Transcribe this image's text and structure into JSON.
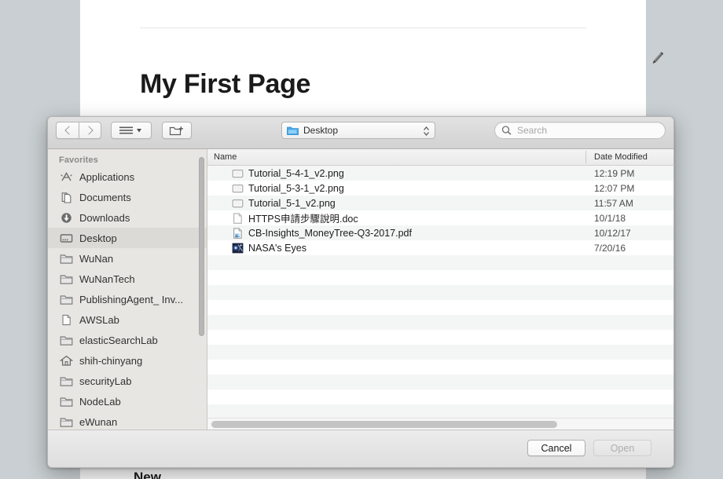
{
  "background": {
    "page_title": "My First Page",
    "edit_icon": "pencil-icon",
    "footer_text": "New"
  },
  "dialog": {
    "toolbar": {
      "back_icon": "chevron-left-icon",
      "forward_icon": "chevron-right-icon",
      "view_icon": "list-view-icon",
      "view_chevron_icon": "chevron-down-icon",
      "new_folder_icon": "new-folder-icon",
      "path": {
        "label": "Desktop",
        "folder_icon": "blue-folder-icon",
        "stepper_icon": "up-down-chevron-icon"
      },
      "search": {
        "placeholder": "Search",
        "icon": "search-icon"
      }
    },
    "sidebar": {
      "header": "Favorites",
      "items": [
        {
          "label": "Applications",
          "icon": "applications-icon",
          "selected": false
        },
        {
          "label": "Documents",
          "icon": "documents-icon",
          "selected": false
        },
        {
          "label": "Downloads",
          "icon": "downloads-icon",
          "selected": false
        },
        {
          "label": "Desktop",
          "icon": "desktop-icon",
          "selected": true
        },
        {
          "label": "WuNan",
          "icon": "folder-icon",
          "selected": false
        },
        {
          "label": "WuNanTech",
          "icon": "folder-icon",
          "selected": false
        },
        {
          "label": "PublishingAgent_ Inv...",
          "icon": "folder-icon",
          "selected": false
        },
        {
          "label": "AWSLab",
          "icon": "document-icon",
          "selected": false
        },
        {
          "label": "elasticSearchLab",
          "icon": "folder-icon",
          "selected": false
        },
        {
          "label": "shih-chinyang",
          "icon": "home-icon",
          "selected": false
        },
        {
          "label": "securityLab",
          "icon": "folder-icon",
          "selected": false
        },
        {
          "label": "NodeLab",
          "icon": "folder-icon",
          "selected": false
        },
        {
          "label": "eWunan",
          "icon": "folder-icon",
          "selected": false
        }
      ]
    },
    "filelist": {
      "columns": {
        "name": "Name",
        "date_modified": "Date Modified"
      },
      "rows": [
        {
          "name": "Tutorial_5-4-1_v2.png",
          "date": "12:19 PM",
          "icon": "image-file-icon"
        },
        {
          "name": "Tutorial_5-3-1_v2.png",
          "date": "12:07 PM",
          "icon": "image-file-icon"
        },
        {
          "name": "Tutorial_5-1_v2.png",
          "date": "11:57 AM",
          "icon": "image-file-icon"
        },
        {
          "name": "HTTPS申請步驟說明.doc",
          "date": "10/1/18",
          "icon": "document-file-icon"
        },
        {
          "name": "CB-Insights_MoneyTree-Q3-2017.pdf",
          "date": "10/12/17",
          "icon": "pdf-file-icon"
        },
        {
          "name": "NASA's Eyes",
          "date": "7/20/16",
          "icon": "app-file-icon"
        }
      ],
      "empty_row_count": 11
    },
    "footer": {
      "cancel_label": "Cancel",
      "open_label": "Open",
      "open_disabled": true
    }
  },
  "colors": {
    "accent_folder_blue": "#4aa8e8",
    "dialog_bg": "#ececec",
    "sidebar_bg": "#e8e6e2",
    "selection_bg": "#dcdad6",
    "desktop_bg": "#c9cfd2"
  }
}
